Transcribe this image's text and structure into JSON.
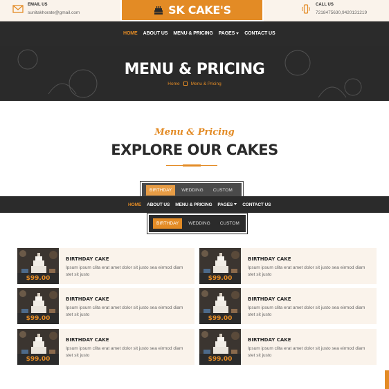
{
  "topbar": {
    "email": {
      "label": "EMAIL US",
      "value": "sunitakhorate@gmail.com",
      "icon": "envelope-icon"
    },
    "call": {
      "label": "CALL US",
      "value": "7218475630,9420131219",
      "icon": "phone-vibrate-icon"
    },
    "brand": {
      "name": "SK CAKE'S",
      "icon": "birthday-cake-icon"
    }
  },
  "nav": {
    "items": [
      {
        "label": "HOME",
        "active": true
      },
      {
        "label": "ABOUT US"
      },
      {
        "label": "MENU & PRICING"
      },
      {
        "label": "PAGES",
        "dropdown": true
      },
      {
        "label": "CONTACT US"
      }
    ]
  },
  "hero": {
    "title": "MENU & PRICING",
    "breadcrumb": {
      "home": "Home",
      "current": "Menu & Pricing"
    }
  },
  "section": {
    "subtitle": "Menu & Pricing",
    "title": "EXPLORE OUR CAKES"
  },
  "tabs": {
    "items": [
      "BIRTHDAY",
      "WEDDING",
      "CUSTOM"
    ],
    "active": "BIRTHDAY"
  },
  "cards": [
    {
      "name": "BIRTHDAY CAKE",
      "desc": "Ipsum ipsum clita erat amet dolor sit justo sea eirmod diam stet sit justo",
      "price": "$99.00"
    },
    {
      "name": "BIRTHDAY CAKE",
      "desc": "Ipsum ipsum clita erat amet dolor sit justo sea eirmod diam stet sit justo",
      "price": "$99.00"
    },
    {
      "name": "BIRTHDAY CAKE",
      "desc": "Ipsum ipsum clita erat amet dolor sit justo sea eirmod diam stet sit justo",
      "price": "$99.00"
    },
    {
      "name": "BIRTHDAY CAKE",
      "desc": "Ipsum ipsum clita erat amet dolor sit justo sea eirmod diam stet sit justo",
      "price": "$99.00"
    },
    {
      "name": "BIRTHDAY CAKE",
      "desc": "Ipsum ipsum clita erat amet dolor sit justo sea eirmod diam stet sit justo",
      "price": "$99.00"
    },
    {
      "name": "BIRTHDAY CAKE",
      "desc": "Ipsum ipsum clita erat amet dolor sit justo sea eirmod diam stet sit justo",
      "price": "$99.00"
    }
  ],
  "colors": {
    "accent": "#e38b25",
    "dark": "#2b2b2b",
    "cream": "#faf3eb"
  }
}
